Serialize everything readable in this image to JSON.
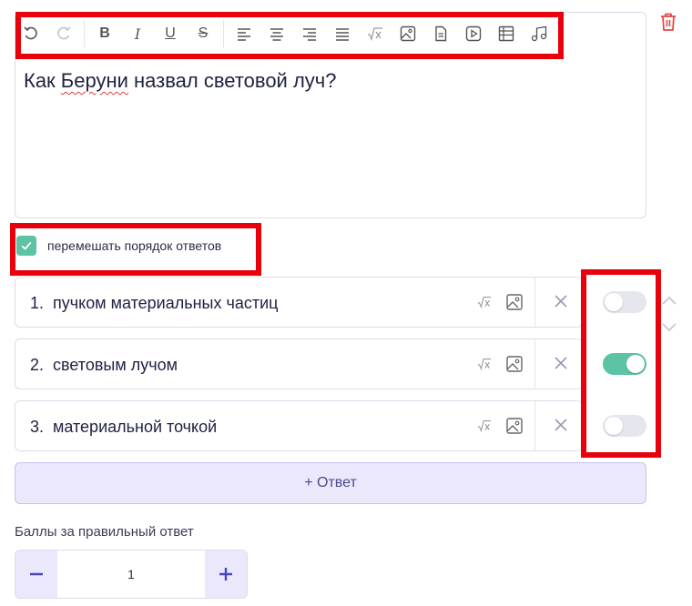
{
  "editor": {
    "question_prefix": "Как ",
    "question_misspelled": "Беруни",
    "question_suffix": " назвал световой луч?",
    "toolbar": {
      "bold_label": "B",
      "italic_label": "I",
      "underline_label": "U",
      "strike_label": "S"
    }
  },
  "shuffle": {
    "label": "перемешать порядок ответов",
    "checked": true
  },
  "answers": [
    {
      "number": "1.",
      "text": "пучком материальных частиц",
      "correct": false
    },
    {
      "number": "2.",
      "text": "световым лучом",
      "correct": true
    },
    {
      "number": "3.",
      "text": "материальной точкой",
      "correct": false
    }
  ],
  "add_answer_label": "+ Ответ",
  "points": {
    "label": "Баллы за правильный ответ",
    "value": "1"
  },
  "colors": {
    "accent_green": "#5cc3a5",
    "accent_purple": "#ebe8fb",
    "highlight_red": "#e8000b",
    "trash_red": "#e04848"
  }
}
